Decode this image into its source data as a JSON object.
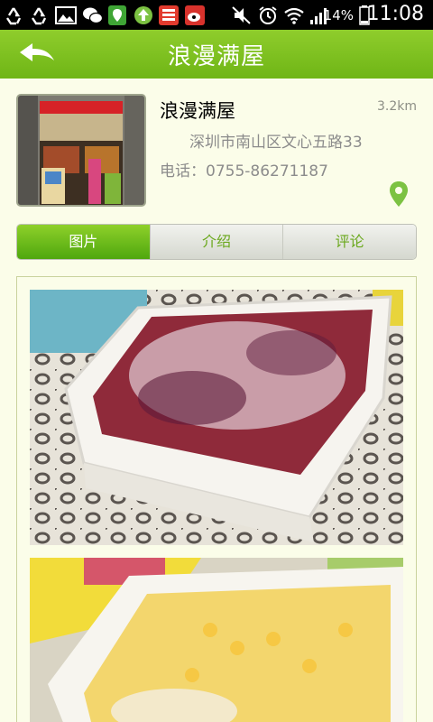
{
  "status_bar": {
    "time": "11:08",
    "battery_percent": "14%",
    "icons": [
      "recycle-icon",
      "recycle-icon",
      "gallery-icon",
      "wechat-icon",
      "map-app-icon",
      "upload-icon",
      "news-icon",
      "weibo-icon",
      "mute-icon",
      "alarm-icon",
      "wifi-icon",
      "signal-icon",
      "battery-icon"
    ]
  },
  "header": {
    "title": "浪漫满屋",
    "back_icon": "back-arrow-icon"
  },
  "store": {
    "name": "浪漫满屋",
    "distance": "3.2km",
    "address": "深圳市南山区文心五路33",
    "phone": "电话：0755-86271187",
    "location_icon": "map-pin-icon"
  },
  "tabs": [
    {
      "label": "图片",
      "active": true
    },
    {
      "label": "介绍",
      "active": false
    },
    {
      "label": "评论",
      "active": false
    }
  ],
  "colors": {
    "accent_green": "#6fb516",
    "background": "#fbfde9"
  }
}
